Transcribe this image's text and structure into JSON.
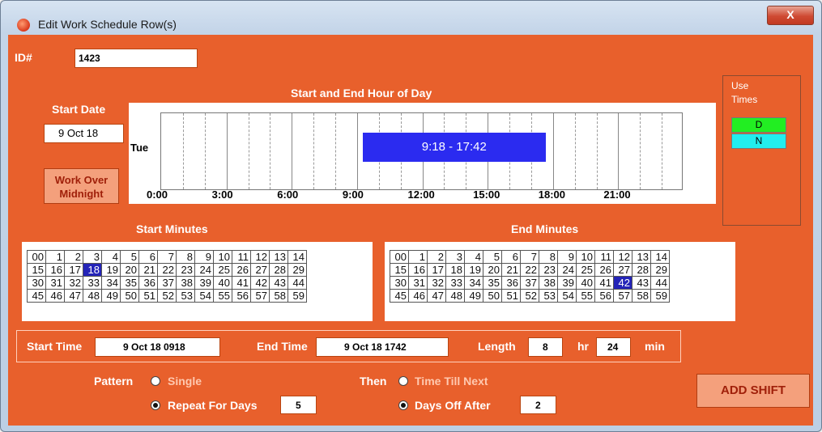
{
  "window": {
    "title": "Edit Work Schedule Row(s)",
    "close_label": "X"
  },
  "id": {
    "label": "ID#",
    "value": "1423"
  },
  "timeline": {
    "heading": "Start and End Hour of Day",
    "row_label": "Tue",
    "hour_labels": [
      "0:00",
      "3:00",
      "6:00",
      "9:00",
      "12:00",
      "15:00",
      "18:00",
      "21:00"
    ],
    "shift_label": "9:18 - 17:42",
    "shift_start_hour": 9.3,
    "shift_end_hour": 17.7,
    "bar_color": "#2b2bf0"
  },
  "start_date": {
    "label": "Start Date",
    "value": "9 Oct 18"
  },
  "work_over_midnight": {
    "label_line1": "Work Over",
    "label_line2": "Midnight"
  },
  "use_times": {
    "label_line1": "Use",
    "label_line2": "Times",
    "items": [
      {
        "label": "D",
        "color": "#22ee22"
      },
      {
        "label": "N",
        "color": "#22eeee"
      }
    ]
  },
  "start_minutes": {
    "heading": "Start Minutes",
    "selected": 18,
    "rows": [
      [
        "00",
        "1",
        "2",
        "3",
        "4",
        "5",
        "6",
        "7",
        "8",
        "9",
        "10",
        "11",
        "12",
        "13",
        "14"
      ],
      [
        "15",
        "16",
        "17",
        "18",
        "19",
        "20",
        "21",
        "22",
        "23",
        "24",
        "25",
        "26",
        "27",
        "28",
        "29"
      ],
      [
        "30",
        "31",
        "32",
        "33",
        "34",
        "35",
        "36",
        "37",
        "38",
        "39",
        "40",
        "41",
        "42",
        "43",
        "44"
      ],
      [
        "45",
        "46",
        "47",
        "48",
        "49",
        "50",
        "51",
        "52",
        "53",
        "54",
        "55",
        "56",
        "57",
        "58",
        "59"
      ]
    ]
  },
  "end_minutes": {
    "heading": "End Minutes",
    "selected": 42,
    "rows": [
      [
        "00",
        "1",
        "2",
        "3",
        "4",
        "5",
        "6",
        "7",
        "8",
        "9",
        "10",
        "11",
        "12",
        "13",
        "14"
      ],
      [
        "15",
        "16",
        "17",
        "18",
        "19",
        "20",
        "21",
        "22",
        "23",
        "24",
        "25",
        "26",
        "27",
        "28",
        "29"
      ],
      [
        "30",
        "31",
        "32",
        "33",
        "34",
        "35",
        "36",
        "37",
        "38",
        "39",
        "40",
        "41",
        "42",
        "43",
        "44"
      ],
      [
        "45",
        "46",
        "47",
        "48",
        "49",
        "50",
        "51",
        "52",
        "53",
        "54",
        "55",
        "56",
        "57",
        "58",
        "59"
      ]
    ]
  },
  "times": {
    "start_label": "Start Time",
    "start_value": "9 Oct 18 0918",
    "end_label": "End Time",
    "end_value": "9 Oct 18 1742",
    "length_label": "Length",
    "length_hr": "8",
    "hr_label": "hr",
    "length_min": "24",
    "min_label": "min"
  },
  "pattern": {
    "label": "Pattern",
    "single_label": "Single",
    "repeat_label": "Repeat For Days",
    "repeat_value": "5"
  },
  "then": {
    "label": "Then",
    "till_next_label": "Time Till Next",
    "days_off_label": "Days Off After",
    "days_off_value": "2"
  },
  "add_shift_label": "ADD SHIFT"
}
